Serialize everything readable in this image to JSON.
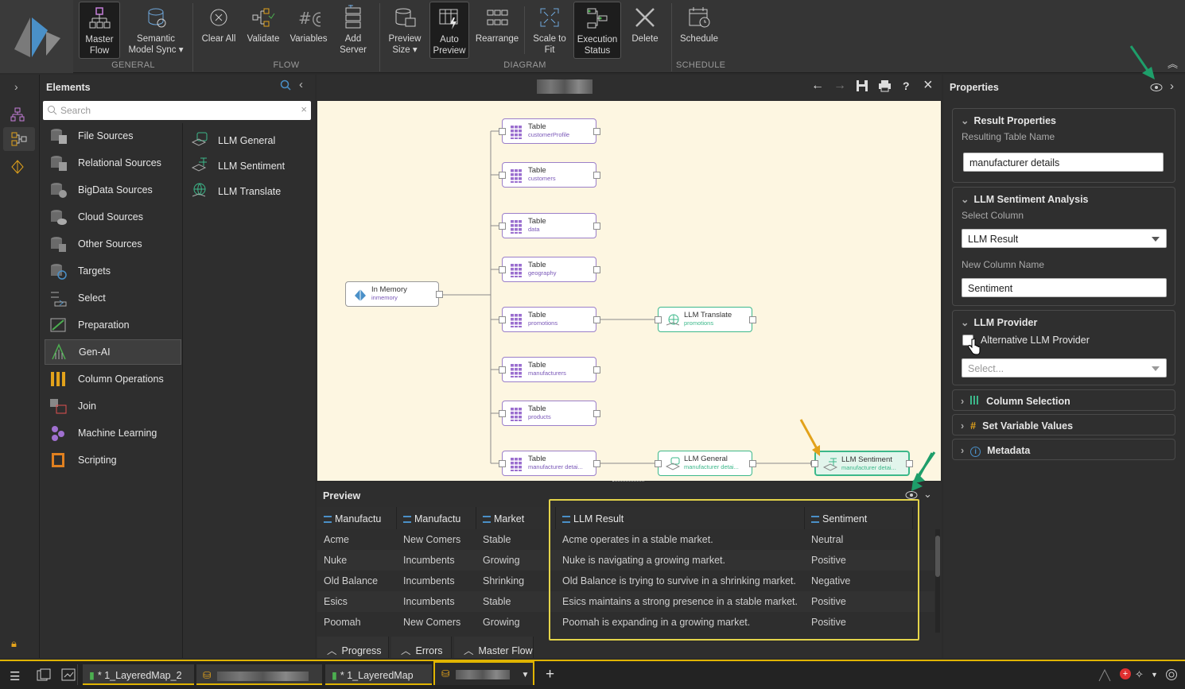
{
  "ribbon": {
    "general": {
      "label": "GENERAL",
      "master_flow": "Master\nFlow",
      "semantic_sync": "Semantic\nModel Sync ▾"
    },
    "flow": {
      "label": "FLOW",
      "clear_all": "Clear All",
      "validate": "Validate",
      "variables": "Variables",
      "add_server": "Add\nServer"
    },
    "diagram": {
      "label": "DIAGRAM",
      "preview_size": "Preview\nSize ▾",
      "auto_preview": "Auto\nPreview",
      "rearrange": "Rearrange",
      "scale_to_fit": "Scale to\nFit",
      "execution_status": "Execution\nStatus",
      "delete": "Delete"
    },
    "schedule": {
      "label": "SCHEDULE",
      "schedule": "Schedule"
    }
  },
  "elements": {
    "title": "Elements",
    "search_placeholder": "Search",
    "categories": [
      "File Sources",
      "Relational Sources",
      "BigData Sources",
      "Cloud Sources",
      "Other Sources",
      "Targets",
      "Select",
      "Preparation",
      "Gen-AI",
      "Column Operations",
      "Join",
      "Machine Learning",
      "Scripting"
    ],
    "selected": "Gen-AI",
    "items": [
      "LLM General",
      "LLM Sentiment",
      "LLM Translate"
    ]
  },
  "canvas": {
    "source": {
      "title": "In Memory",
      "sub": "inmemory"
    },
    "tables": [
      {
        "title": "Table",
        "sub": "customerProfile"
      },
      {
        "title": "Table",
        "sub": "customers"
      },
      {
        "title": "Table",
        "sub": "data"
      },
      {
        "title": "Table",
        "sub": "geography"
      },
      {
        "title": "Table",
        "sub": "promotions"
      },
      {
        "title": "Table",
        "sub": "manufacturers"
      },
      {
        "title": "Table",
        "sub": "products"
      },
      {
        "title": "Table",
        "sub": "manufacturer detai..."
      }
    ],
    "llm_translate": {
      "title": "LLM Translate",
      "sub": "promotions"
    },
    "llm_general": {
      "title": "LLM General",
      "sub": "manufacturer detai..."
    },
    "llm_sentiment": {
      "title": "LLM Sentiment",
      "sub": "manufacturer detai..."
    }
  },
  "preview": {
    "title": "Preview",
    "columns": [
      "Manufactu",
      "Manufactu",
      "Market",
      "LLM Result",
      "Sentiment"
    ],
    "rows": [
      [
        "Acme",
        "New Comers",
        "Stable",
        "Acme operates in a stable market.",
        "Neutral"
      ],
      [
        "Nuke",
        "Incumbents",
        "Growing",
        "Nuke is navigating a growing market.",
        "Positive"
      ],
      [
        "Old Balance",
        "Incumbents",
        "Shrinking",
        "Old Balance is trying to survive in a shrinking market.",
        "Negative"
      ],
      [
        "Esics",
        "Incumbents",
        "Stable",
        "Esics maintains a strong presence in a stable market.",
        "Positive"
      ],
      [
        "Poomah",
        "New Comers",
        "Growing",
        "Poomah is expanding in a growing market.",
        "Positive"
      ]
    ],
    "tabs": [
      "Progress",
      "Errors",
      "Master Flow"
    ]
  },
  "properties": {
    "title": "Properties",
    "result": {
      "title": "Result Properties",
      "label": "Resulting Table Name",
      "value": "manufacturer details"
    },
    "sentiment": {
      "title": "LLM Sentiment Analysis",
      "select_label": "Select Column",
      "select_value": "LLM Result",
      "new_col_label": "New Column Name",
      "new_col_value": "Sentiment"
    },
    "provider": {
      "title": "LLM Provider",
      "checkbox_label": "Alternative LLM Provider",
      "select_placeholder": "Select..."
    },
    "collapsed": [
      "Column Selection",
      "Set Variable Values",
      "Metadata"
    ]
  },
  "taskbar": {
    "tabs": [
      "* 1_LayeredMap_2",
      "",
      "* 1_LayeredMap",
      ""
    ]
  },
  "colors": {
    "accent": "#e0b400",
    "node_border": "#9b7fc9",
    "llm_border": "#3cb88a",
    "annotation_green": "#1e9e6a",
    "annotation_orange": "#e2a21b",
    "highlight": "#e4d44a"
  }
}
